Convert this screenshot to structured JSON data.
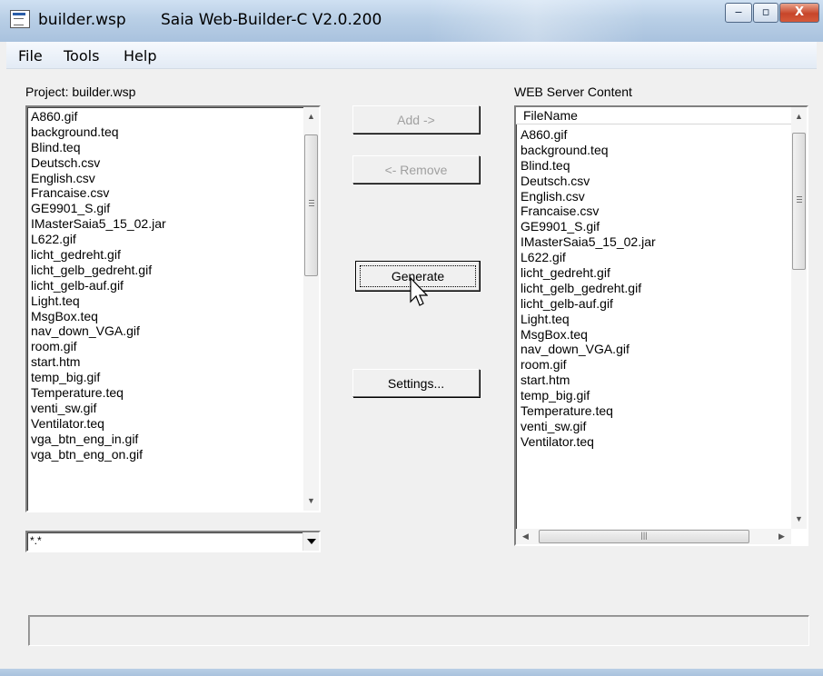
{
  "window": {
    "filename": "builder.wsp",
    "app_title": "Saia Web-Builder-C  V2.0.200",
    "minimize_glyph": "‒",
    "maximize_glyph": "▫",
    "close_glyph": "X"
  },
  "menu": [
    "File",
    "Tools",
    "Help"
  ],
  "project": {
    "label": "Project: builder.wsp",
    "files": [
      "A860.gif",
      "background.teq",
      "Blind.teq",
      "Deutsch.csv",
      "English.csv",
      "Francaise.csv",
      "GE9901_S.gif",
      "IMasterSaia5_15_02.jar",
      "L622.gif",
      "licht_gedreht.gif",
      "licht_gelb_gedreht.gif",
      "licht_gelb-auf.gif",
      "Light.teq",
      "MsgBox.teq",
      "nav_down_VGA.gif",
      "room.gif",
      "start.htm",
      "temp_big.gif",
      "Temperature.teq",
      "venti_sw.gif",
      "Ventilator.teq",
      "vga_btn_eng_in.gif",
      "vga_btn_eng_on.gif"
    ],
    "filter": "*.*"
  },
  "web_server": {
    "label": "WEB Server Content",
    "column_header": "FileName",
    "files": [
      "A860.gif",
      "background.teq",
      "Blind.teq",
      "Deutsch.csv",
      "English.csv",
      "Francaise.csv",
      "GE9901_S.gif",
      "IMasterSaia5_15_02.jar",
      "L622.gif",
      "licht_gedreht.gif",
      "licht_gelb_gedreht.gif",
      "licht_gelb-auf.gif",
      "Light.teq",
      "MsgBox.teq",
      "nav_down_VGA.gif",
      "room.gif",
      "start.htm",
      "temp_big.gif",
      "Temperature.teq",
      "venti_sw.gif",
      "Ventilator.teq"
    ]
  },
  "buttons": {
    "add": "Add ->",
    "remove": "<- Remove",
    "generate": "Generate",
    "settings": "Settings..."
  },
  "status_text": ""
}
